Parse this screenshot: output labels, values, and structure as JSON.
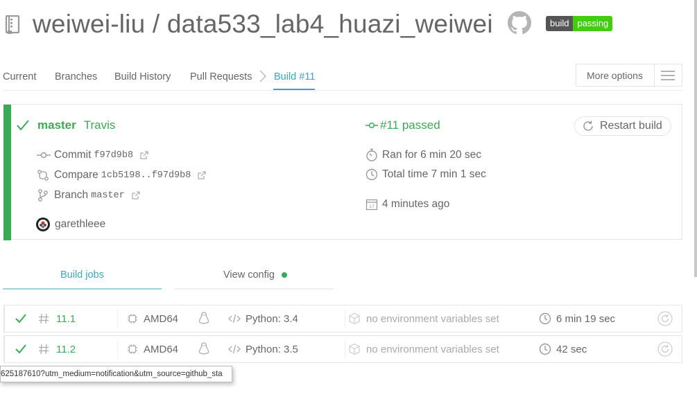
{
  "header": {
    "title": "weiwei-liu / data533_lab4_huazi_weiwei",
    "badge_left": "build",
    "badge_right": "passing"
  },
  "tabs": {
    "current": "Current",
    "branches": "Branches",
    "build_history": "Build History",
    "pull_requests": "Pull Requests",
    "build": "Build #11",
    "more_options": "More options"
  },
  "build": {
    "branch": "master",
    "source": "Travis",
    "commit_label": "Commit",
    "commit_sha": "f97d9b8",
    "compare_label": "Compare",
    "compare_range": "1cb5198..f97d9b8",
    "branch_label": "Branch",
    "branch_name": "master",
    "author": "garethleee",
    "status": "#11 passed",
    "ran_for": "Ran for 6 min 20 sec",
    "total_time": "Total time 7 min 1 sec",
    "ago": "4 minutes ago",
    "restart": "Restart build"
  },
  "subtabs": {
    "build_jobs": "Build jobs",
    "view_config": "View config"
  },
  "jobs": [
    {
      "number": "11.1",
      "arch": "AMD64",
      "language": "Python: 3.4",
      "env": "no environment variables set",
      "duration": "6 min 19 sec"
    },
    {
      "number": "11.2",
      "arch": "AMD64",
      "language": "Python: 3.5",
      "env": "no environment variables set",
      "duration": "42 sec"
    }
  ],
  "tooltip": "625187610?utm_medium=notification&utm_source=github_sta",
  "colors": {
    "passed": "#39aa56",
    "accent": "#3ea7b7",
    "badge_green": "#44cc11"
  },
  "icons": [
    "repo-icon",
    "github-icon",
    "chevron-right-icon",
    "hamburger-icon",
    "check-icon",
    "commit-icon",
    "external-link-icon",
    "compare-icon",
    "branch-icon",
    "avatar",
    "stopwatch-icon",
    "clock-icon",
    "calendar-icon",
    "restart-icon",
    "hash-icon",
    "cpu-icon",
    "linux-icon",
    "code-icon",
    "box-icon"
  ]
}
